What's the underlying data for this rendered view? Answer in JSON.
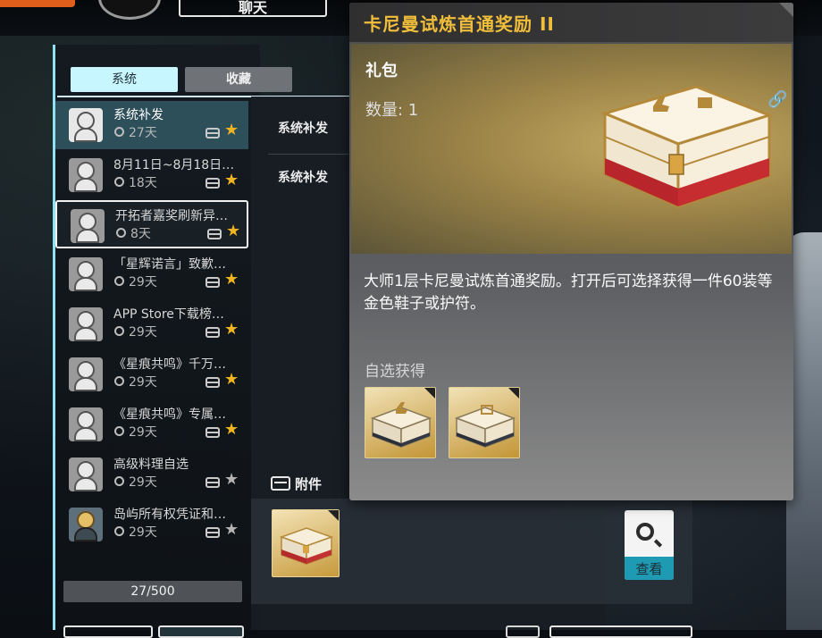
{
  "top": {
    "chat_label": "聊天"
  },
  "tabs": {
    "system": "系统",
    "favorites": "收藏"
  },
  "mails": [
    {
      "title": "系统补发",
      "days": "27天",
      "starred": true,
      "avatar": "default"
    },
    {
      "title": "8月11日~8月18日…",
      "days": "18天",
      "starred": true,
      "avatar": "default"
    },
    {
      "title": "开拓者嘉奖刷新异…",
      "days": "8天",
      "starred": true,
      "avatar": "default"
    },
    {
      "title": "「星辉诺言」致歉…",
      "days": "29天",
      "starred": true,
      "avatar": "default"
    },
    {
      "title": "APP Store下载榜…",
      "days": "29天",
      "starred": true,
      "avatar": "default"
    },
    {
      "title": "《星痕共鸣》千万…",
      "days": "29天",
      "starred": true,
      "avatar": "default"
    },
    {
      "title": "《星痕共鸣》专属…",
      "days": "29天",
      "starred": true,
      "avatar": "default"
    },
    {
      "title": "高级料理自选",
      "days": "29天",
      "starred": false,
      "avatar": "default"
    },
    {
      "title": "岛屿所有权凭证和…",
      "days": "29天",
      "starred": false,
      "avatar": "character"
    }
  ],
  "mail_count": "27/500",
  "detail": {
    "sender_1": "系统补发",
    "sender_2": "系统补发",
    "attachments_label": "附件",
    "view_button": "查看"
  },
  "popup": {
    "title": "卡尼曼试炼首通奖励 II",
    "item_type": "礼包",
    "quantity": "数量: 1",
    "description": "大师1层卡尼曼试炼首通奖励。打开后可选择获得一件60装等金色鞋子或护符。",
    "options_label": "自选获得",
    "options": [
      "boot-chest",
      "amulet-chest"
    ]
  },
  "colors": {
    "accent_cyan": "#8fe3f0",
    "title_gold": "#f0be3a",
    "star_gold": "#f0b322",
    "view_teal": "#1f9ab3"
  }
}
